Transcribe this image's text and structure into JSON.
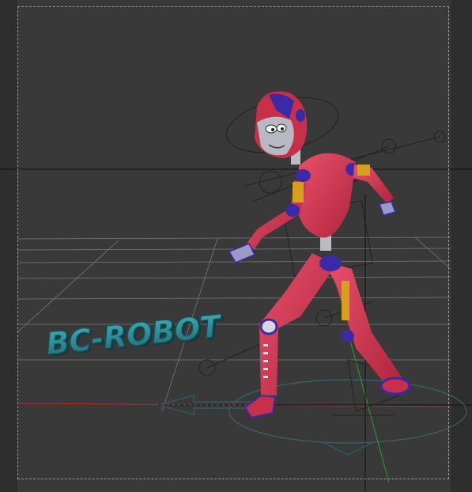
{
  "scene": {
    "logo_text": "BC-ROBOT",
    "viewport_background": "#393939",
    "accent": {
      "robot_red": "#d43a55",
      "robot_blue": "#3a2aa8",
      "logo_teal": "#2a8a95",
      "x_axis": "#b03030",
      "y_axis": "#2fa02f"
    }
  }
}
